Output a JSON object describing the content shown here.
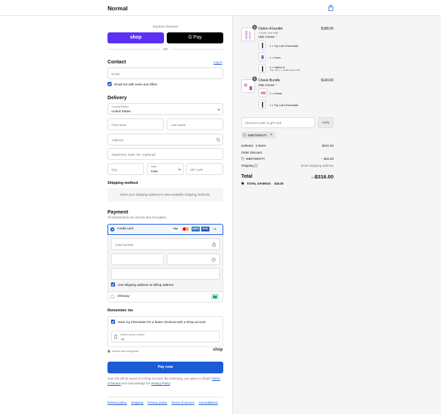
{
  "header": {
    "brand": "Normal",
    "cart_icon": "shopping-bag-icon"
  },
  "express": {
    "label": "Express checkout",
    "shop_label": "shop",
    "gpay_label": "G Pay",
    "or": "OR"
  },
  "contact": {
    "title": "Contact",
    "login": "Log in",
    "email_placeholder": "Email",
    "news_label": "Email me with news and offers"
  },
  "delivery": {
    "title": "Delivery",
    "country_label": "Country/Region",
    "country_value": "United States",
    "first_name": "First name",
    "last_name": "Last name",
    "address": "Address",
    "apartment": "Apartment, suite, etc. (optional)",
    "city": "City",
    "state_label": "State",
    "state_value": "Iowa",
    "zip": "ZIP code"
  },
  "shipping_method": {
    "title": "Shipping method",
    "message": "Enter your shipping address to view available shipping methods."
  },
  "payment": {
    "title": "Payment",
    "subtitle": "All transactions are secure and encrypted.",
    "credit_card": "Credit card",
    "card_brands": [
      "VISA",
      "MC",
      "AMEX",
      "DISC"
    ],
    "more_brands": "+1",
    "card_number": "Card number",
    "billing_label": "Use shipping address as billing address",
    "afterpay": "Afterpay"
  },
  "remember": {
    "title": "Remember me",
    "save_label": "Save my information for a faster checkout with a Shop account",
    "phone_label": "Mobile phone number",
    "phone_prefix": "+1",
    "secure": "Secure and encrypted",
    "shop": "shop"
  },
  "pay": {
    "button": "Pay now",
    "legal_prefix": "Your info will be saved to a Shop account. By continuing, you agree to Shop's",
    "terms": "Terms of Service",
    "legal_mid": "and acknowledge the",
    "privacy": "Privacy Policy",
    "legal_end": "."
  },
  "footer_links": [
    "Refund policy",
    "Shipping",
    "Privacy policy",
    "Terms of service",
    "Cancellations"
  ],
  "summary": {
    "items": [
      {
        "name": "Option A bundle",
        "sub": "1 bullet and refill",
        "toggle": "Hide 3 items",
        "qty": "1",
        "price": "$188.00",
        "children": [
          {
            "label": "1 × Toy Care Essentials",
            "sub": ""
          },
          {
            "label": "1 × Gunn",
            "sub": ""
          },
          {
            "label": "1 × Option A",
            "sub": "The OG | 1 bullet and refill"
          }
        ]
      },
      {
        "name": "Cheek Bundle",
        "sub": "",
        "toggle": "Hide 2 items",
        "qty": "1",
        "price": "$143.00",
        "children": [
          {
            "label": "1 × Cheek",
            "sub": ""
          },
          {
            "label": "1 × Toy Care Essentials",
            "sub": ""
          }
        ]
      }
    ],
    "discount_placeholder": "Discount code or gift card",
    "apply": "Apply",
    "code": "IMBITWENTY",
    "subtotal_label": "Subtotal · 2 items",
    "subtotal": "$331.00",
    "order_discount": "Order discount",
    "discount_code": "IMBITWENTY",
    "discount_amount": "− $15.00",
    "shipping_label": "Shipping",
    "shipping_value": "Enter shipping address",
    "total_label": "Total",
    "currency": "USD",
    "total": "$316.00",
    "savings_label": "TOTAL SAVINGS",
    "savings": "$15.00"
  },
  "colors": {
    "accent": "#1a5bd6",
    "shop_purple": "#5a31f4",
    "afterpay": "#b2fce4"
  }
}
